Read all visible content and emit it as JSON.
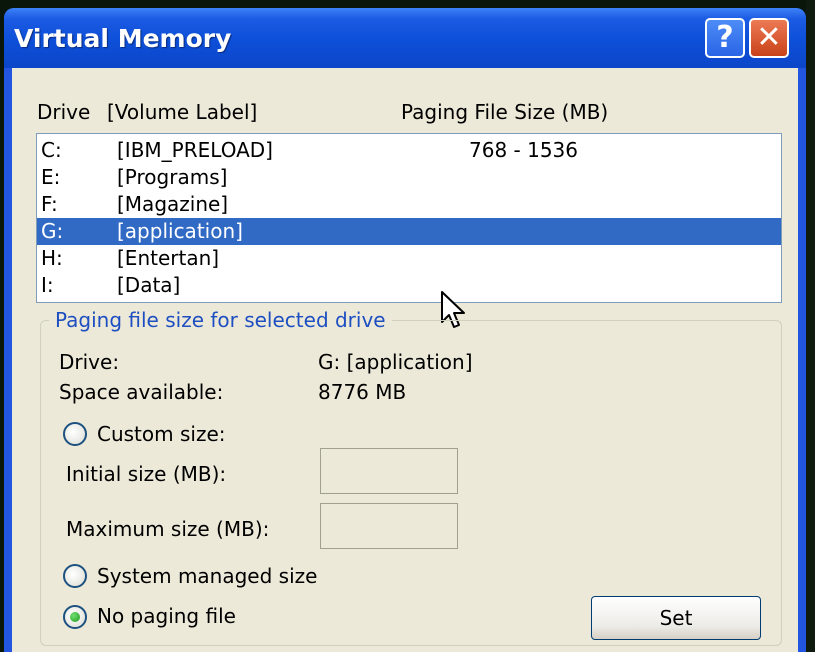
{
  "window": {
    "title": "Virtual Memory",
    "help_label": "?",
    "close_label": "✕"
  },
  "list_header": {
    "drive": "Drive",
    "volume_label": "[Volume Label]",
    "paging_size": "Paging File Size (MB)"
  },
  "drives": [
    {
      "letter": "C:",
      "label": "[IBM_PRELOAD]",
      "size": "768 - 1536",
      "selected": false
    },
    {
      "letter": "E:",
      "label": "[Programs]",
      "size": "",
      "selected": false
    },
    {
      "letter": "F:",
      "label": "[Magazine]",
      "size": "",
      "selected": false
    },
    {
      "letter": "G:",
      "label": "[application]",
      "size": "",
      "selected": true
    },
    {
      "letter": "H:",
      "label": "[Entertan]",
      "size": "",
      "selected": false
    },
    {
      "letter": "I:",
      "label": "[Data]",
      "size": "",
      "selected": false
    }
  ],
  "group": {
    "title": "Paging file size for selected drive",
    "drive_label": "Drive:",
    "drive_value": "G:  [application]",
    "space_label": "Space available:",
    "space_value": "8776 MB",
    "custom_size_label": "Custom size:",
    "initial_size_label": "Initial size (MB):",
    "initial_size_value": "",
    "maximum_size_label": "Maximum size (MB):",
    "maximum_size_value": "",
    "system_managed_label": "System managed size",
    "no_paging_label": "No paging file",
    "selected_option": "no_paging",
    "set_label": "Set"
  },
  "colors": {
    "title_bar": "#0d4fd8",
    "selection": "#316ac5",
    "group_title": "#1e4fc2",
    "dialog_face": "#ece9d8"
  },
  "icons": {
    "cursor": "arrow-cursor-icon",
    "radio_selected": "radio-checked-icon"
  }
}
